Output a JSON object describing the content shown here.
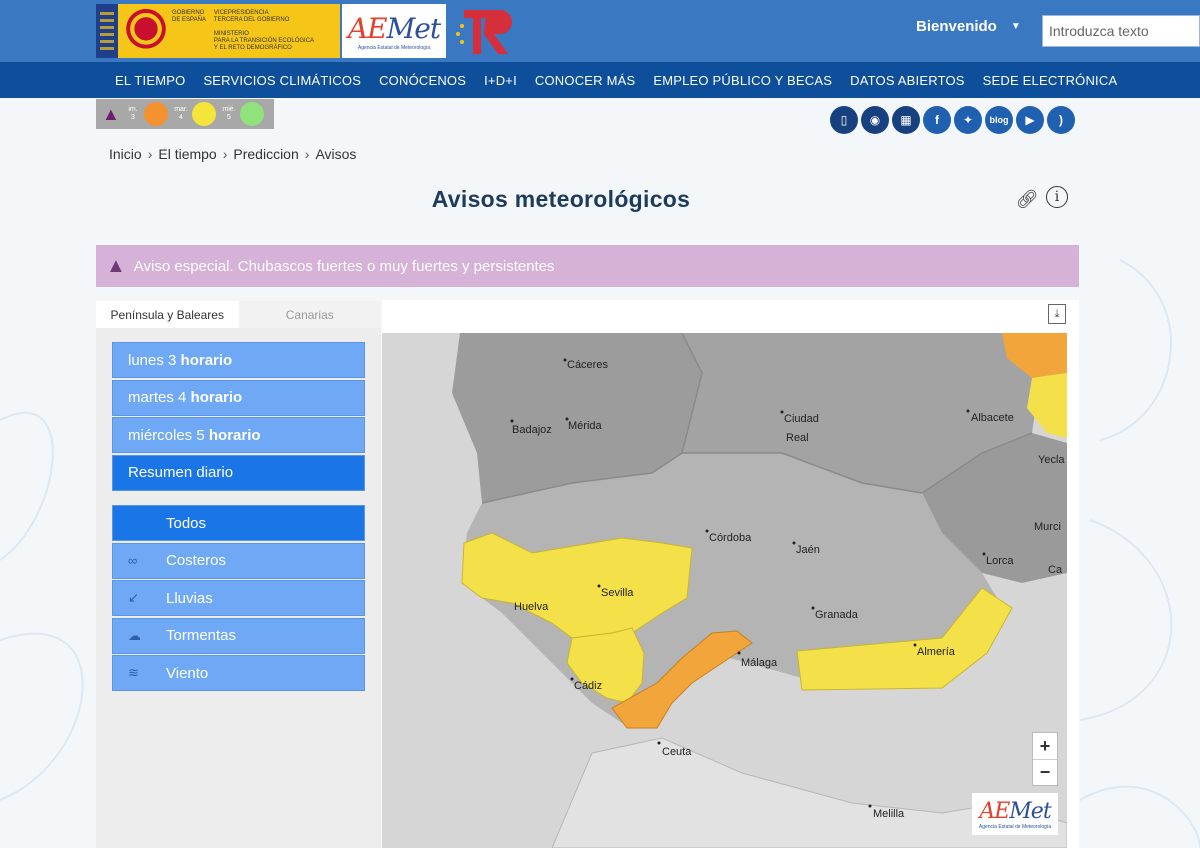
{
  "header": {
    "gov_texts": [
      "GOBIERNO\nDE ESPAÑA",
      "VICEPRESIDENCIA\nTERCERA DEL GOBIERNO\n\nMINISTERIO\nPARA LA TRANSICIÓN ECOLÓGICA\nY EL RETO DEMOGRÁFICO"
    ],
    "aemet_word": "Met",
    "aemet_word_a": "AE",
    "aemet_sub": "Agencia Estatal de Meteorología",
    "welcome": "Bienvenido",
    "search_placeholder": "Introduzca texto"
  },
  "nav": [
    "EL TIEMPO",
    "SERVICIOS CLIMÁTICOS",
    "CONÓCENOS",
    "I+D+I",
    "CONOCER MÁS",
    "EMPLEO PÚBLICO Y BECAS",
    "DATOS ABIERTOS",
    "SEDE ELECTRÓNICA"
  ],
  "legend": {
    "levels": [
      {
        "label": "im.\n3",
        "color": "#f5922f"
      },
      {
        "label": "mar.\n4",
        "color": "#f5e53a"
      },
      {
        "label": "mié.\n5",
        "color": "#8fe37a"
      }
    ]
  },
  "social": [
    "mobile",
    "radio",
    "apps",
    "f",
    "twitter",
    "blog",
    "youtube",
    "rss"
  ],
  "social_text": {
    "blog": "blog",
    "f": "f"
  },
  "breadcrumb": [
    "Inicio",
    "El tiempo",
    "Prediccion",
    "Avisos"
  ],
  "page_title": "Avisos meteorológicos",
  "alert": "Aviso especial. Chubascos fuertes o muy fuertes y persistentes",
  "tabs": [
    "Península y Baleares",
    "Canarias"
  ],
  "days": [
    {
      "pre": "lunes 3 ",
      "bold": "horario"
    },
    {
      "pre": "martes 4 ",
      "bold": "horario"
    },
    {
      "pre": "miércoles 5 ",
      "bold": "horario"
    },
    {
      "pre": "Resumen diario",
      "bold": ""
    }
  ],
  "filters": [
    {
      "label": "Todos",
      "icon": ""
    },
    {
      "label": "Costeros",
      "icon": "∞"
    },
    {
      "label": "Lluvias",
      "icon": "↙"
    },
    {
      "label": "Tormentas",
      "icon": "☁"
    },
    {
      "label": "Viento",
      "icon": "≋"
    }
  ],
  "map": {
    "cities": [
      "Cáceres",
      "Badajoz",
      "Mérida",
      "Ciudad",
      "Real",
      "Albacete",
      "Yecla",
      "Córdoba",
      "Jaén",
      "Murci",
      "Lorca",
      "Ca",
      "Sevilla",
      "Huelva",
      "Granada",
      "Almería",
      "Málaga",
      "Cádiz",
      "Ceuta",
      "Melilla"
    ],
    "colors": {
      "yellow": "#f4e14a",
      "orange": "#f2a53a"
    },
    "zoom_in": "+",
    "zoom_out": "−",
    "download": "⤓"
  }
}
